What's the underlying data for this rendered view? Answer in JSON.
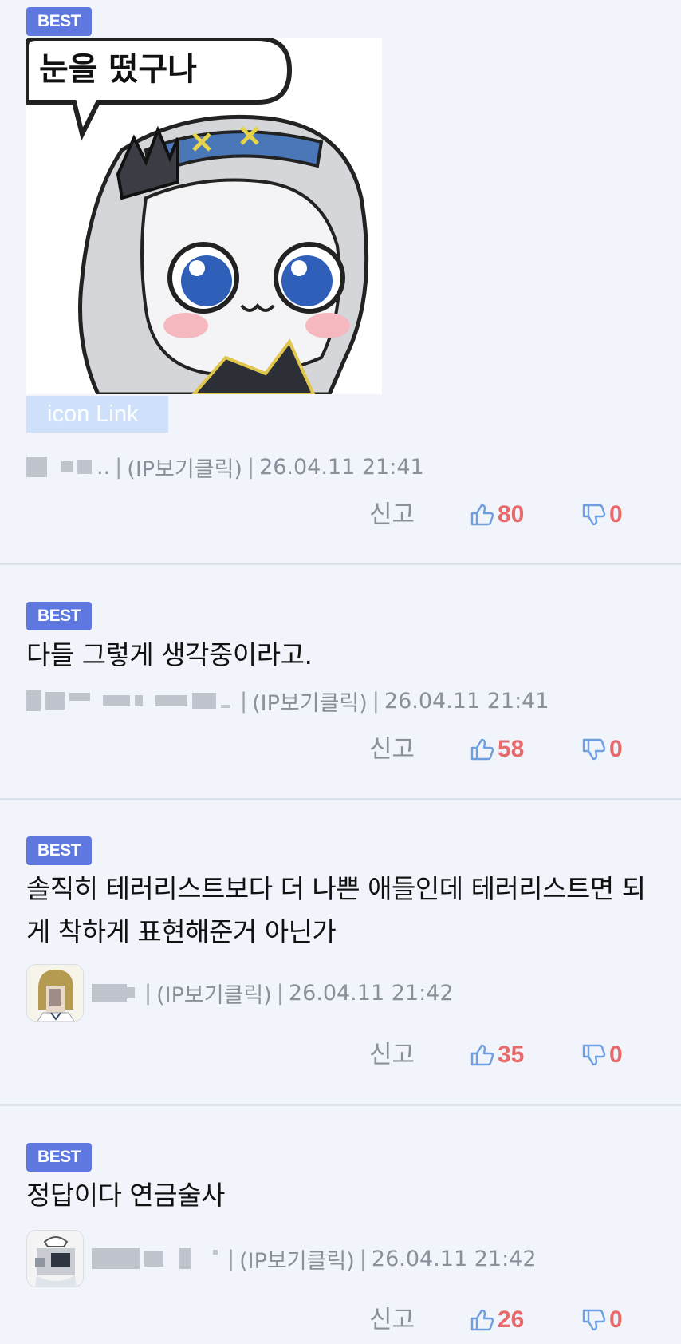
{
  "comments": [
    {
      "badge": "BEST",
      "sticker_text": "눈을 떴구나",
      "icon_link_label": "icon Link",
      "nick_suffix": "..",
      "ip_label": "(IP보기클릭)",
      "datetime": "26.04.11 21:41",
      "report_label": "신고",
      "likes": "80",
      "dislikes": "0"
    },
    {
      "badge": "BEST",
      "text": "다들 그렇게 생각중이라고.",
      "ip_label": "(IP보기클릭)",
      "datetime": "26.04.11 21:41",
      "report_label": "신고",
      "likes": "58",
      "dislikes": "0"
    },
    {
      "badge": "BEST",
      "text": "솔직히 테러리스트보다 더 나쁜 애들인데 테러리스트면 되게 착하게 표현해준거 아닌가",
      "ip_label": "(IP보기클릭)",
      "datetime": "26.04.11 21:42",
      "report_label": "신고",
      "likes": "35",
      "dislikes": "0"
    },
    {
      "badge": "BEST",
      "text": "정답이다 연금술사",
      "ip_label": "(IP보기클릭)",
      "datetime": "26.04.11 21:42",
      "report_label": "신고",
      "likes": "26",
      "dislikes": "0"
    }
  ],
  "icons": {
    "like": "thumbs-up-icon",
    "dislike": "thumbs-down-icon"
  },
  "colors": {
    "background": "#f1f5fb",
    "badge": "#5f78e0",
    "vote_count": "#e86a6a",
    "vote_icon": "#6f9fe0",
    "meta_text": "#8a8f99"
  }
}
